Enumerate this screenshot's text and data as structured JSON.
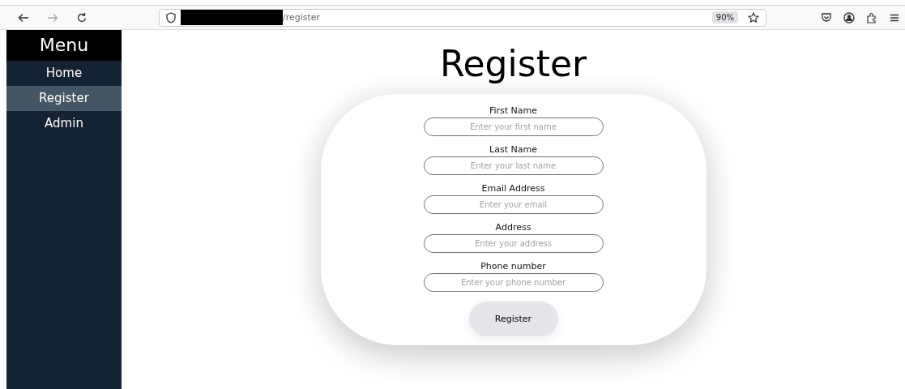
{
  "browser": {
    "url": "/register",
    "zoom": "90%"
  },
  "sidebar": {
    "title": "Menu",
    "items": [
      {
        "label": "Home",
        "selected": false
      },
      {
        "label": "Register",
        "selected": true
      },
      {
        "label": "Admin",
        "selected": false
      }
    ]
  },
  "page": {
    "title": "Register"
  },
  "form": {
    "fields": [
      {
        "label": "First Name",
        "placeholder": "Enter your first name"
      },
      {
        "label": "Last Name",
        "placeholder": "Enter your last name"
      },
      {
        "label": "Email Address",
        "placeholder": "Enter your email"
      },
      {
        "label": "Address",
        "placeholder": "Enter your address"
      },
      {
        "label": "Phone number",
        "placeholder": "Enter your phone number"
      }
    ],
    "submit": "Register"
  }
}
